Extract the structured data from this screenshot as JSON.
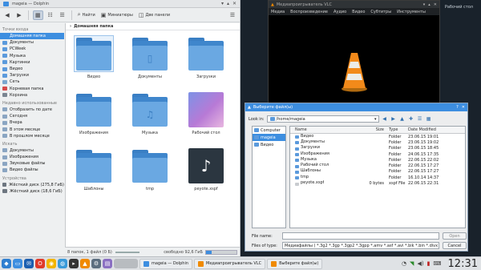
{
  "desktop": {
    "label": "Рабочий стол"
  },
  "dolphin": {
    "title": "mageia — Dolphin",
    "toolbar": {
      "icons_label": "Миниатюры",
      "find_label": "Найти",
      "split_label": "Две панели"
    },
    "breadcrumb": "Домашняя папка",
    "places": {
      "section_places": "Точки входа",
      "items": [
        "Домашняя папка",
        "Документы",
        "PCWeek",
        "Музыка",
        "Картинки",
        "Видео",
        "Загрузки",
        "Сеть",
        "Корневая папка",
        "Корзина"
      ],
      "section_recent": "Недавно использованные",
      "recent": [
        "Отобразить по дате",
        "Сегодня",
        "Вчера",
        "В этом месяце",
        "В прошлом месяце"
      ],
      "section_search": "Искать",
      "search": [
        "Документы",
        "Изображения",
        "Звуковые файлы",
        "Видео файлы"
      ],
      "section_devices": "Устройства",
      "devices": [
        "Жёсткий диск (275,8 ГиБ)",
        "Жёсткий диск (18,6 ГиБ)"
      ]
    },
    "files": [
      {
        "name": "Видео",
        "kind": "folder",
        "glyph": ""
      },
      {
        "name": "Документы",
        "kind": "folder",
        "glyph": "▯"
      },
      {
        "name": "Загрузки",
        "kind": "folder",
        "glyph": ""
      },
      {
        "name": "Изображения",
        "kind": "folder",
        "glyph": ""
      },
      {
        "name": "Музыка",
        "kind": "folder",
        "glyph": "♫"
      },
      {
        "name": "Рабочий стол",
        "kind": "desktop",
        "glyph": ""
      },
      {
        "name": "Шаблоны",
        "kind": "folder",
        "glyph": ""
      },
      {
        "name": "tmp",
        "kind": "folder",
        "glyph": ""
      },
      {
        "name": "peyote.xspf",
        "kind": "xspf",
        "glyph": "♪"
      }
    ],
    "status": {
      "summary": "8 папок, 1 файл (0 Б)",
      "free": "свободно 92,6 ГиБ",
      "free_used_fraction": 0.18
    }
  },
  "vlc": {
    "title": "Медиапроигрыватель VLC",
    "menu": [
      "Медиа",
      "Воспроизведение",
      "Аудио",
      "Видео",
      "Субтитры",
      "Инструменты"
    ]
  },
  "dialog": {
    "title": "Выберите файл(ы)",
    "look_in_label": "Look in:",
    "look_in_value": "/home/mageia",
    "sidebar": [
      "Computer",
      "mageia",
      "Видео"
    ],
    "columns": [
      "Name",
      "Size",
      "Type",
      "Date Modified"
    ],
    "rows": [
      {
        "name": "Видео",
        "size": "",
        "type": "Folder",
        "date": "23.06.15 19:01",
        "doc": false
      },
      {
        "name": "Документы",
        "size": "",
        "type": "Folder",
        "date": "23.06.15 19:02",
        "doc": false
      },
      {
        "name": "Загрузки",
        "size": "",
        "type": "Folder",
        "date": "23.06.15 18:45",
        "doc": false
      },
      {
        "name": "Изображения",
        "size": "",
        "type": "Folder",
        "date": "24.06.15 17:35",
        "doc": false
      },
      {
        "name": "Музыка",
        "size": "",
        "type": "Folder",
        "date": "22.06.15 22:02",
        "doc": false
      },
      {
        "name": "Рабочий стол",
        "size": "",
        "type": "Folder",
        "date": "22.06.15 17:27",
        "doc": false
      },
      {
        "name": "Шаблоны",
        "size": "",
        "type": "Folder",
        "date": "22.06.15 17:27",
        "doc": false
      },
      {
        "name": "tmp",
        "size": "",
        "type": "Folder",
        "date": "16.10.14 14:37",
        "doc": false
      },
      {
        "name": "peyote.xspf",
        "size": "0 bytes",
        "type": "xspf File",
        "date": "22.06.15 22:31",
        "doc": true
      }
    ],
    "file_name_label": "File name:",
    "file_name_value": "",
    "file_type_label": "Files of type:",
    "file_type_value": "Медиафайлы ( *.3g2 *.3gp *.3gp2 *.3gpp *.amv *.asf *.avi *.bik *.bin *.divx *.dr",
    "open_label": "Open",
    "cancel_label": "Cancel"
  },
  "taskbar": {
    "tasks": [
      "mageia — Dolphin",
      "Медиапроигрыватель VLC",
      "Выберите файл(ы)"
    ],
    "clock": "12:31"
  }
}
